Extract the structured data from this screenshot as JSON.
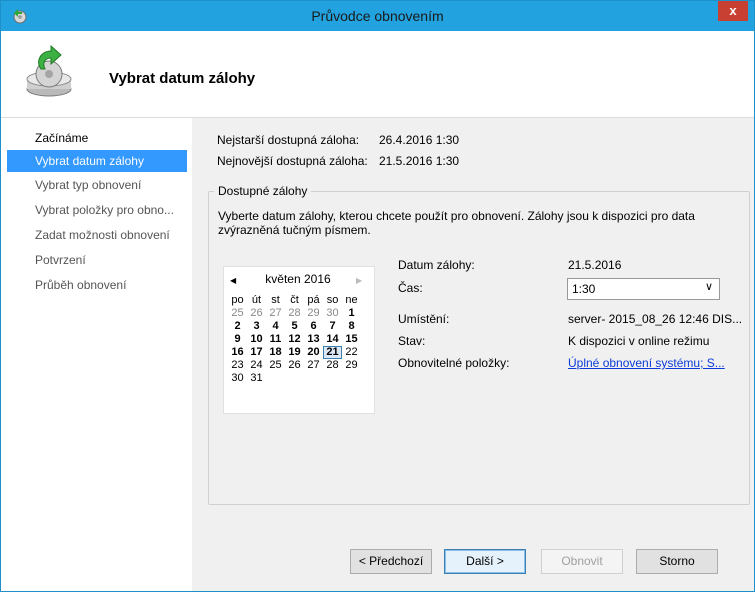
{
  "window": {
    "title": "Průvodce obnovením",
    "close_glyph": "x",
    "colors": {
      "titlebar": "#22a3e0",
      "close": "#c84031",
      "accent": "#3399ff",
      "link": "#0b3ad8"
    }
  },
  "header": {
    "icon": "backup-restore-icon",
    "title": "Vybrat datum zálohy"
  },
  "nav": {
    "items": [
      {
        "label": "Začínáme",
        "state": "done"
      },
      {
        "label": "Vybrat datum zálohy",
        "state": "active"
      },
      {
        "label": "Vybrat typ obnovení",
        "state": "pending"
      },
      {
        "label": "Vybrat položky pro obno...",
        "state": "pending"
      },
      {
        "label": "Zadat možnosti obnovení",
        "state": "pending"
      },
      {
        "label": "Potvrzení",
        "state": "pending"
      },
      {
        "label": "Průběh obnovení",
        "state": "pending"
      }
    ]
  },
  "info": {
    "oldest_label": "Nejstarší dostupná záloha:",
    "oldest_value": "26.4.2016 1:30",
    "newest_label": "Nejnovější dostupná záloha:",
    "newest_value": "21.5.2016 1:30"
  },
  "group": {
    "title": "Dostupné zálohy",
    "instruction": "Vyberte datum zálohy, kterou chcete použít pro obnovení. Zálohy jsou k dispozici pro data zvýrazněná tučným písmem."
  },
  "calendar": {
    "month": "květen 2016",
    "prev_glyph": "◀",
    "next_glyph": "▶",
    "weekdays": [
      "po",
      "út",
      "st",
      "čt",
      "pá",
      "so",
      "ne"
    ],
    "weeks": [
      [
        {
          "d": "25",
          "s": "muted"
        },
        {
          "d": "26",
          "s": "muted"
        },
        {
          "d": "27",
          "s": "muted"
        },
        {
          "d": "28",
          "s": "muted"
        },
        {
          "d": "29",
          "s": "muted"
        },
        {
          "d": "30",
          "s": "muted"
        },
        {
          "d": "1",
          "s": "bold"
        }
      ],
      [
        {
          "d": "2",
          "s": "bold"
        },
        {
          "d": "3",
          "s": "bold"
        },
        {
          "d": "4",
          "s": "bold"
        },
        {
          "d": "5",
          "s": "bold"
        },
        {
          "d": "6",
          "s": "bold"
        },
        {
          "d": "7",
          "s": "bold"
        },
        {
          "d": "8",
          "s": "bold"
        }
      ],
      [
        {
          "d": "9",
          "s": "bold"
        },
        {
          "d": "10",
          "s": "bold"
        },
        {
          "d": "11",
          "s": "bold"
        },
        {
          "d": "12",
          "s": "bold"
        },
        {
          "d": "13",
          "s": "bold"
        },
        {
          "d": "14",
          "s": "bold"
        },
        {
          "d": "15",
          "s": "bold"
        }
      ],
      [
        {
          "d": "16",
          "s": "bold"
        },
        {
          "d": "17",
          "s": "bold"
        },
        {
          "d": "18",
          "s": "bold"
        },
        {
          "d": "19",
          "s": "bold"
        },
        {
          "d": "20",
          "s": "bold"
        },
        {
          "d": "21",
          "s": "selected"
        },
        {
          "d": "22",
          "s": "normal"
        }
      ],
      [
        {
          "d": "23",
          "s": "normal"
        },
        {
          "d": "24",
          "s": "normal"
        },
        {
          "d": "25",
          "s": "normal"
        },
        {
          "d": "26",
          "s": "normal"
        },
        {
          "d": "27",
          "s": "normal"
        },
        {
          "d": "28",
          "s": "normal"
        },
        {
          "d": "29",
          "s": "normal"
        }
      ],
      [
        {
          "d": "30",
          "s": "normal"
        },
        {
          "d": "31",
          "s": "normal"
        }
      ]
    ]
  },
  "details": {
    "date_label": "Datum zálohy:",
    "date_value": "21.5.2016",
    "time_label": "Čas:",
    "time_value": "1:30",
    "time_arrow": "∨",
    "location_label": "Umístění:",
    "location_value": "server- 2015_08_26 12:46 DIS...",
    "status_label": "Stav:",
    "status_value": "K dispozici v online režimu",
    "items_label": "Obnovitelné položky:",
    "items_value": "Úplné obnovení systému; S..."
  },
  "buttons": {
    "prev": "< Předchozí",
    "next": "Další >",
    "restore": "Obnovit",
    "cancel": "Storno"
  }
}
